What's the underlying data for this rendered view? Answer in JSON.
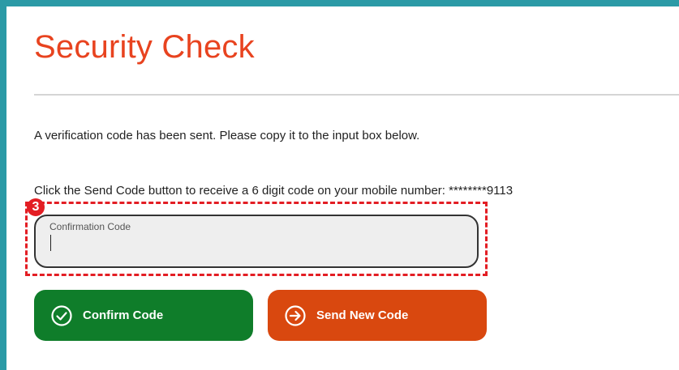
{
  "page": {
    "title": "Security Check",
    "message_sent": "A verification code has been sent. Please copy it to the input box below.",
    "instructions": "Click the Send Code button to receive a 6 digit code on your mobile number: ********9113"
  },
  "annotation": {
    "step_number": "3"
  },
  "form": {
    "confirmation_code": {
      "label": "Confirmation Code",
      "value": ""
    }
  },
  "buttons": {
    "confirm_label": "Confirm Code",
    "send_label": "Send New Code"
  },
  "colors": {
    "frame": "#2b9aa6",
    "title": "#e8431f",
    "confirm_button": "#0f7d2a",
    "send_button": "#d9480f",
    "annotation": "#e31e24"
  },
  "icons": {
    "confirm": "check-circle-icon",
    "send": "arrow-right-circle-icon"
  }
}
